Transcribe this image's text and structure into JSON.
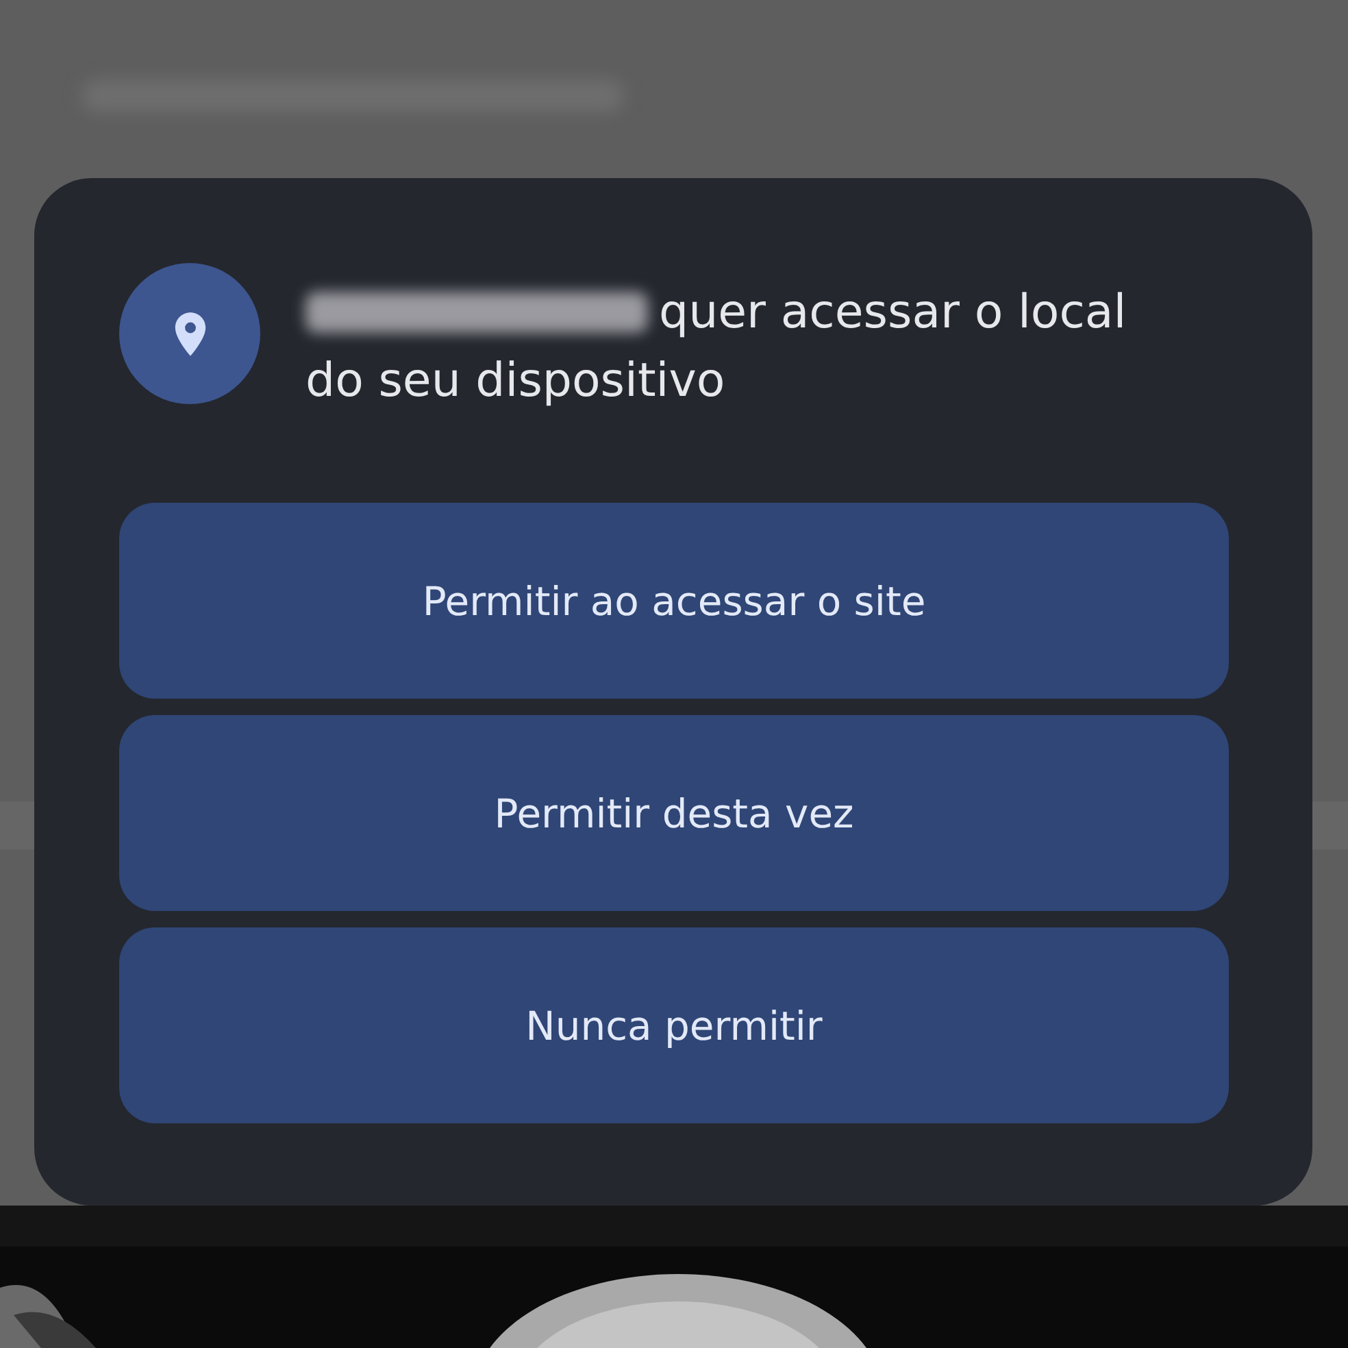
{
  "dialog": {
    "message": "quer acessar o local do seu dispositivo",
    "buttons": [
      {
        "label": "Permitir ao acessar o site"
      },
      {
        "label": "Permitir desta vez"
      },
      {
        "label": "Nunca permitir"
      }
    ]
  }
}
